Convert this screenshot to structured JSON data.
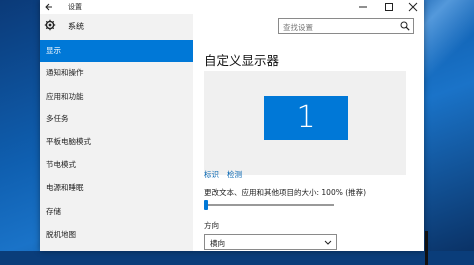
{
  "window": {
    "title": "设置",
    "controls": {
      "minimize": "minimize",
      "maximize": "maximize",
      "close": "close"
    }
  },
  "sidebar": {
    "heading": "系统",
    "items": [
      {
        "label": "显示",
        "active": true
      },
      {
        "label": "通知和操作",
        "active": false
      },
      {
        "label": "应用和功能",
        "active": false
      },
      {
        "label": "多任务",
        "active": false
      },
      {
        "label": "平板电脑模式",
        "active": false
      },
      {
        "label": "节电模式",
        "active": false
      },
      {
        "label": "电源和睡眠",
        "active": false
      },
      {
        "label": "存储",
        "active": false
      },
      {
        "label": "脱机地图",
        "active": false
      }
    ]
  },
  "search": {
    "placeholder": "查找设置"
  },
  "main": {
    "title": "自定义显示器",
    "monitor_number": "1",
    "identify_label": "标识",
    "detect_label": "检测",
    "scale_label": "更改文本、应用和其他项目的大小: 100% (推荐)",
    "scale_level": 0.0,
    "orientation_label": "方向",
    "orientation_value": "横向"
  },
  "colors": {
    "accent": "#0078d7",
    "link": "#0063b1",
    "sidebar_bg": "#f2f2f2"
  },
  "icons": {
    "back": "back-arrow-icon",
    "gear": "gear-icon",
    "search": "search-icon",
    "dropdown": "chevron-down-icon"
  }
}
